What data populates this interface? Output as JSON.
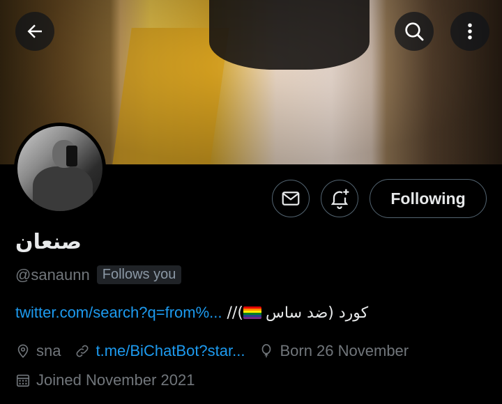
{
  "header": {
    "back_icon": "arrow-left-icon",
    "search_icon": "search-icon",
    "more_icon": "more-vertical-icon"
  },
  "profile": {
    "display_name": "صنعان",
    "handle": "@sanaunn",
    "follows_you": "Follows you",
    "following_label": "Following",
    "bio_link": "twitter.com/search?q=from%...",
    "bio_sep": " //(",
    "bio_text": "كورد (ضد ساس",
    "location": "sna",
    "website": "t.me/BiChatBot?star...",
    "birthday": "Born 26 November",
    "joined": "Joined November 2021"
  },
  "colors": {
    "accent": "#1d9bf0",
    "muted": "#71767b",
    "text": "#e7e9ea",
    "background": "#000000"
  }
}
